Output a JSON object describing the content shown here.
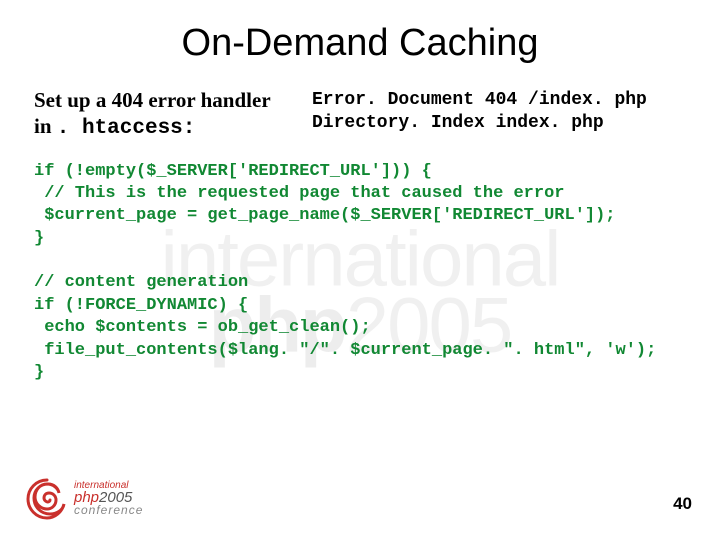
{
  "title": "On-Demand Caching",
  "intro": {
    "prefix": "Set up a 404 error handler in ",
    "mono": ". htaccess:"
  },
  "htaccess": "Error. Document 404 /index. php\nDirectory. Index index. php",
  "code1": "if (!empty($_SERVER['REDIRECT_URL'])) {\n // This is the requested page that caused the error\n $current_page = get_page_name($_SERVER['REDIRECT_URL']);\n}",
  "code2": "// content generation\nif (!FORCE_DYNAMIC) {\n echo $contents = ob_get_clean();\n file_put_contents($lang. \"/\". $current_page. \". html\", 'w');\n}",
  "watermark": {
    "line1": "international",
    "line2a": "php",
    "line2b": "2005"
  },
  "logo": {
    "line1": "international",
    "line2a": "php",
    "line2b": "2005",
    "line3": "conference"
  },
  "page": "40"
}
